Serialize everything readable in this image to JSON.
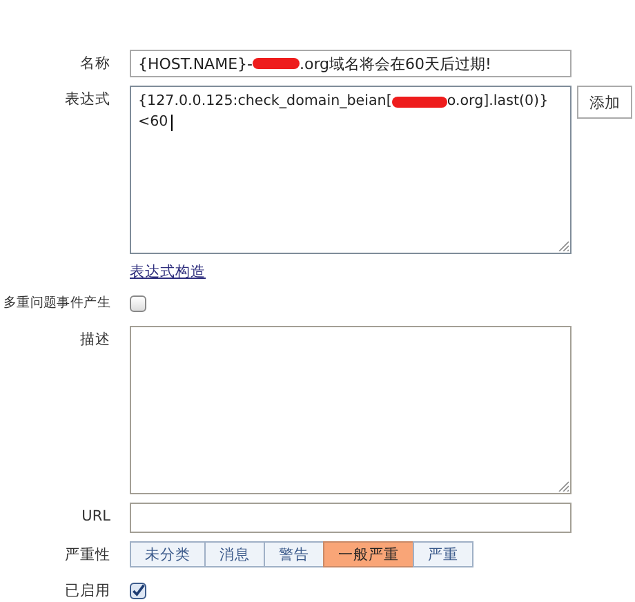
{
  "name": {
    "label": "名称",
    "value_before": "{HOST.NAME}-",
    "value_after": ".org域名将会在60天后过期!"
  },
  "expression": {
    "label": "表达式",
    "line1_before": "{127.0.0.125:check_domain_beian[",
    "line1_after": "o.org].last(0)}",
    "line2": "<60",
    "add_button": "添加",
    "constructor_link": "表达式构造"
  },
  "multiple_events": {
    "label": "多重问题事件产生",
    "checked": false
  },
  "description": {
    "label": "描述"
  },
  "url": {
    "label": "URL"
  },
  "severity": {
    "label": "严重性",
    "options": [
      {
        "label": "未分类",
        "selected": false
      },
      {
        "label": "消息",
        "selected": false
      },
      {
        "label": "警告",
        "selected": false
      },
      {
        "label": "一般严重",
        "selected": true
      },
      {
        "label": "严重",
        "selected": false
      }
    ]
  },
  "enabled": {
    "label": "已启用",
    "checked": true
  }
}
